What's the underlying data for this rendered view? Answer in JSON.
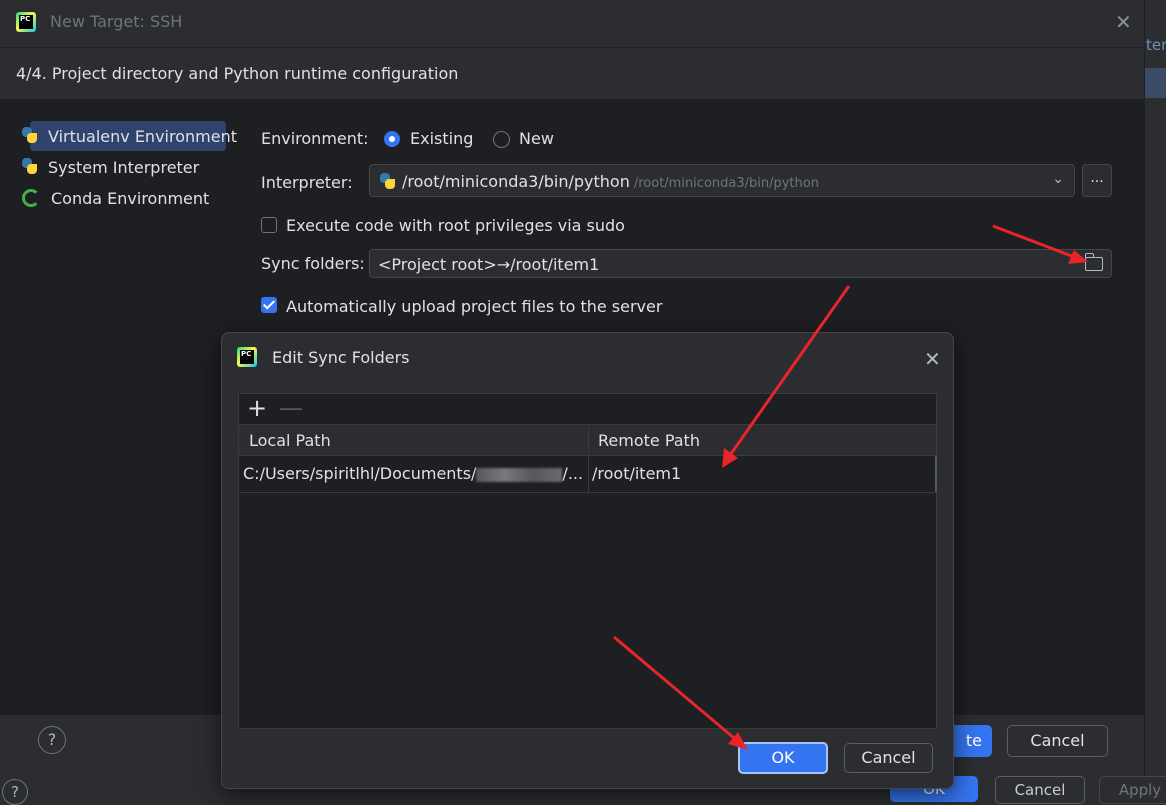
{
  "main": {
    "title": "New Target: SSH",
    "step": "4/4. Project directory and Python runtime configuration",
    "sidebar": [
      {
        "label": "Virtualenv Environment",
        "icon": "python-virtualenv-icon"
      },
      {
        "label": "System Interpreter",
        "icon": "python-icon"
      },
      {
        "label": "Conda Environment",
        "icon": "conda-icon"
      }
    ],
    "environment_label": "Environment:",
    "env_existing": "Existing",
    "env_new": "New",
    "interpreter_label": "Interpreter:",
    "interpreter_value": "/root/miniconda3/bin/python",
    "interpreter_hint": "/root/miniconda3/bin/python",
    "more_label": "...",
    "sudo_label": "Execute code with root privileges via sudo",
    "sync_label": "Sync folders:",
    "sync_value": "<Project root>→/root/item1",
    "auto_upload_label": "Automatically upload project files to the server",
    "help_label": "?",
    "primary_label": "te",
    "cancel_label": "Cancel"
  },
  "background": {
    "right_text": "ter",
    "ok_label": "OK",
    "cancel_label": "Cancel",
    "apply_label": "Apply",
    "help_label": "?"
  },
  "sync_dialog": {
    "title": "Edit Sync Folders",
    "add": "+",
    "remove": "—",
    "col_local": "Local Path",
    "col_remote": "Remote Path",
    "rows": [
      {
        "local_prefix": "C:/Users/spiritlhl/Documents/",
        "local_suffix": "/...",
        "remote": "/root/item1"
      }
    ],
    "ok_label": "OK",
    "cancel_label": "Cancel"
  },
  "colors": {
    "accent": "#3574f0",
    "arrow": "#e8252a"
  }
}
